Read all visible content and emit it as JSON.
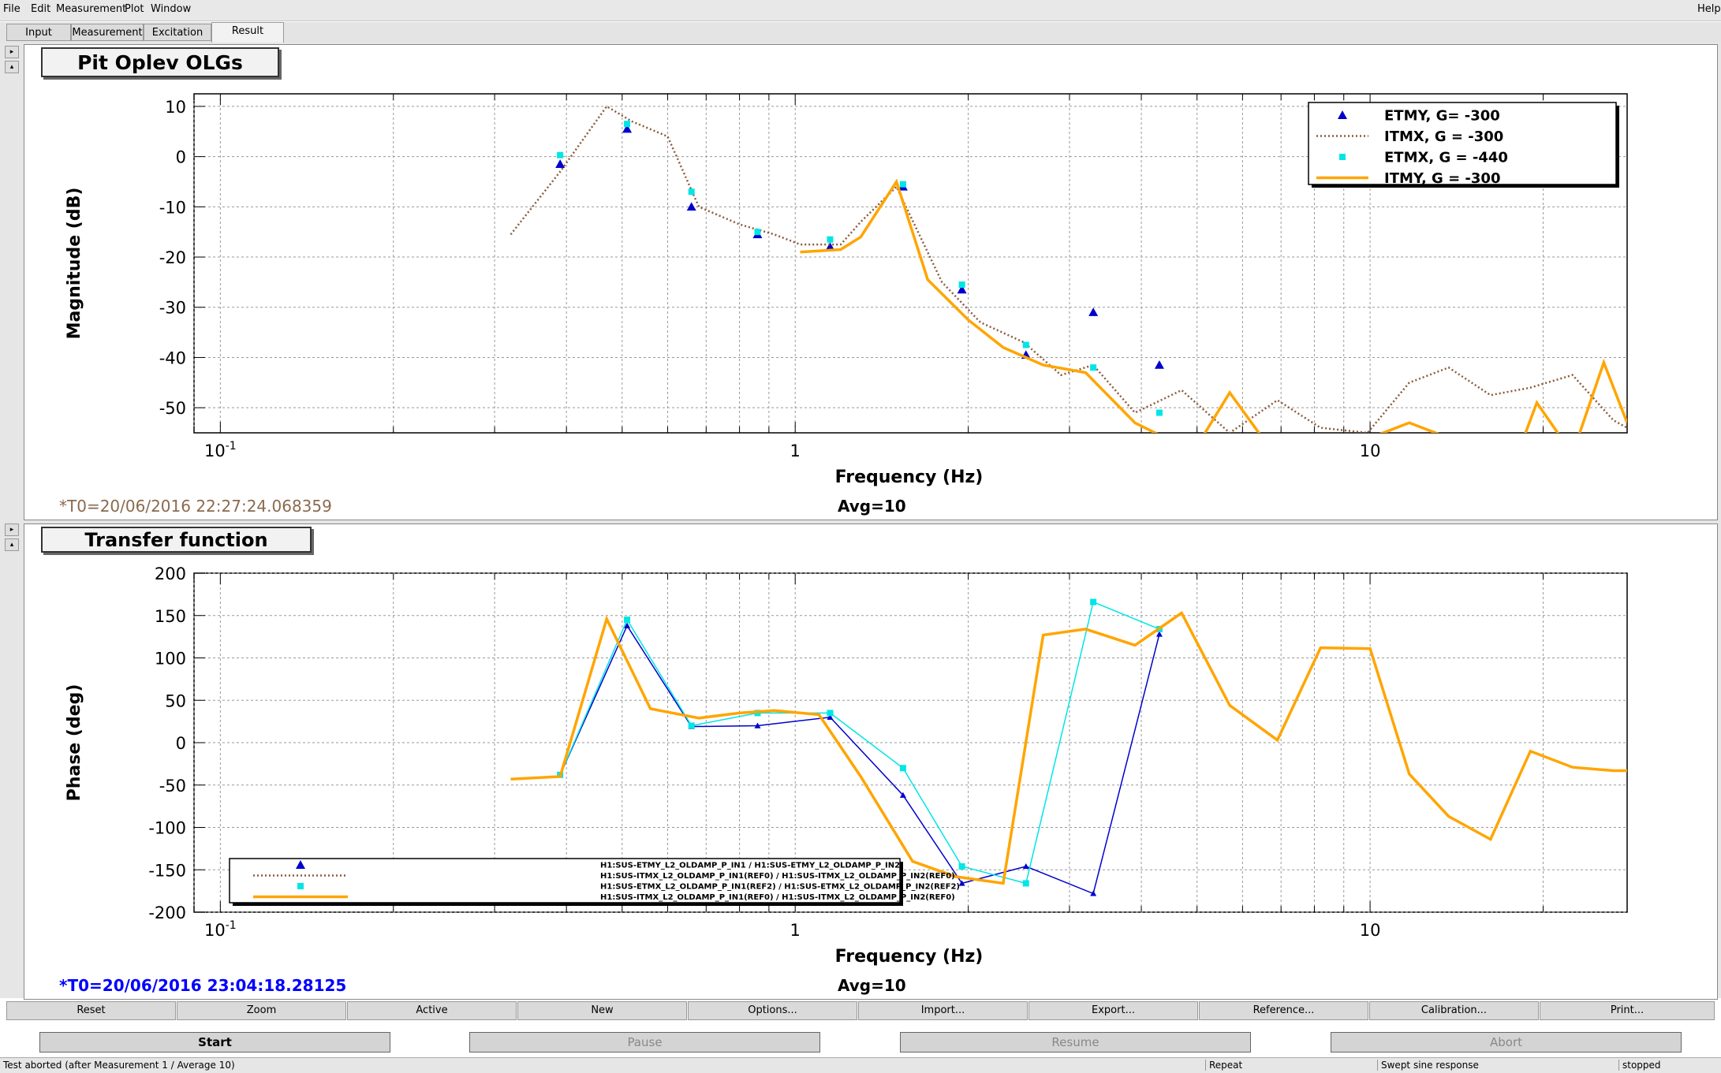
{
  "menubar": {
    "items": [
      "File",
      "Edit",
      "Measurement",
      "Plot",
      "Window"
    ],
    "help": "Help"
  },
  "tabs": [
    {
      "label": "Input",
      "active": false
    },
    {
      "label": "Measurement",
      "active": false
    },
    {
      "label": "Excitation",
      "active": false
    },
    {
      "label": "Result",
      "active": true
    }
  ],
  "pad1": {
    "title": "Pit Oplev OLGs",
    "timestamp": "*T0=20/06/2016 22:27:24.068359",
    "timestamp_color": "#8b6a4e",
    "avg": "Avg=10"
  },
  "pad2": {
    "title": "Transfer function",
    "timestamp": "*T0=20/06/2016 23:04:18.28125",
    "timestamp_color": "#0000ff",
    "avg": "Avg=10"
  },
  "chart_data": [
    {
      "type": "line",
      "xlabel": "Frequency (Hz)",
      "ylabel": "Magnitude (dB)",
      "xscale": "log",
      "xlim": [
        0.09,
        28
      ],
      "ylim": [
        -55,
        12.5
      ],
      "xticks": [
        {
          "v": 0.1,
          "base": "10",
          "exp": "-1"
        },
        {
          "v": 1,
          "base": "1",
          "exp": ""
        },
        {
          "v": 10,
          "base": "10",
          "exp": ""
        }
      ],
      "yticks": [
        10,
        0,
        -10,
        -20,
        -30,
        -40,
        -50
      ],
      "grid": true,
      "legend_position": "top-right",
      "series": [
        {
          "name": "ETMY, G= -300",
          "style": "triangle",
          "color": "#0000cc",
          "x": [
            0.39,
            0.51,
            0.66,
            0.86,
            1.15,
            1.54,
            1.95,
            2.52,
            3.3,
            4.3
          ],
          "y": [
            -1.5,
            5.5,
            -10,
            -15.5,
            -18,
            -6,
            -26.5,
            -39.5,
            -31,
            -41.5
          ]
        },
        {
          "name": "ITMX, G = -300",
          "style": "dotted",
          "color": "#8b5a3c",
          "x": [
            0.32,
            0.39,
            0.47,
            0.52,
            0.6,
            0.68,
            0.8,
            0.92,
            1.02,
            1.2,
            1.3,
            1.5,
            1.8,
            2.1,
            2.5,
            2.9,
            3.3,
            3.9,
            4.7,
            5.7,
            6.9,
            8.2,
            9.9,
            11.7,
            13.7,
            16.2,
            19.0,
            22.5,
            26.5,
            28
          ],
          "y": [
            -15.5,
            -3,
            10,
            7,
            4,
            -10,
            -13.5,
            -15.5,
            -17.5,
            -17.5,
            -13,
            -6,
            -25,
            -33,
            -37,
            -43.5,
            -41.5,
            -51,
            -46.5,
            -55,
            -48.5,
            -54,
            -55,
            -45,
            -42,
            -47.5,
            -46,
            -43.5,
            -52.5,
            -54
          ]
        },
        {
          "name": "ETMX, G = -440",
          "style": "square",
          "color": "#00e5e5",
          "x": [
            0.39,
            0.51,
            0.66,
            0.86,
            1.15,
            1.54,
            1.95,
            2.52,
            3.3,
            4.3
          ],
          "y": [
            0.3,
            6.5,
            -7,
            -15,
            -16.5,
            -5.5,
            -25.5,
            -37.5,
            -42,
            -51
          ]
        },
        {
          "name": "ITMY, G = -300",
          "style": "solid",
          "color": "#ffa500",
          "x": [
            1.02,
            1.2,
            1.3,
            1.5,
            1.7,
            2.0,
            2.3,
            2.7,
            3.2,
            3.9,
            4.4,
            5.1,
            5.7,
            6.5,
            8.0,
            10.0,
            11.7,
            13.7,
            16.0,
            18.5,
            19.5,
            21.5,
            23.0,
            25.5,
            28
          ],
          "y": [
            -19,
            -18.5,
            -16,
            -5,
            -24.5,
            -32.5,
            -38,
            -41.5,
            -43,
            -53,
            -56,
            -56,
            -47,
            -56,
            -56,
            -56,
            -53,
            -56,
            -56,
            -56,
            -49,
            -56,
            -56,
            -41,
            -53
          ]
        }
      ]
    },
    {
      "type": "line",
      "xlabel": "Frequency (Hz)",
      "ylabel": "Phase (deg)",
      "xscale": "log",
      "xlim": [
        0.09,
        28
      ],
      "ylim": [
        -200,
        200
      ],
      "xticks": [
        {
          "v": 0.1,
          "base": "10",
          "exp": "-1"
        },
        {
          "v": 1,
          "base": "1",
          "exp": ""
        },
        {
          "v": 10,
          "base": "10",
          "exp": ""
        }
      ],
      "yticks": [
        200,
        150,
        100,
        50,
        0,
        -50,
        -100,
        -150,
        -200
      ],
      "grid": true,
      "legend_position": "bottom-left",
      "series": [
        {
          "name": "H1:SUS-ETMY_L2_OLDAMP_P_IN1 / H1:SUS-ETMY_L2_OLDAMP_P_IN2",
          "style": "triangle-line",
          "color": "#0000cc",
          "x": [
            0.39,
            0.51,
            0.66,
            0.86,
            1.15,
            1.54,
            1.95,
            2.52,
            3.3,
            4.3
          ],
          "y": [
            -38,
            138,
            19,
            20,
            30,
            -62,
            -166,
            -146,
            -178,
            128
          ]
        },
        {
          "name": "H1:SUS-ITMX_L2_OLDAMP_P_IN1(REF0) / H1:SUS-ITMX_L2_OLDAMP_P_IN2(REF0)",
          "style": "dotted",
          "color": "#8b5a3c",
          "x": [
            0.32,
            0.39,
            0.47,
            0.56,
            0.68,
            0.8,
            0.92,
            1.1,
            1.3,
            1.6,
            1.9,
            2.3,
            2.7,
            3.2,
            3.9,
            4.7,
            5.7,
            6.9,
            8.2,
            10.0,
            11.7,
            13.7,
            16.2,
            19.0,
            22.5,
            26.5,
            28
          ],
          "y": [
            -43,
            -40,
            146,
            40,
            29,
            35,
            38,
            33,
            -40,
            -140,
            -158,
            -166,
            127,
            134,
            115,
            153,
            44,
            3,
            112,
            111,
            -37,
            -87,
            -114,
            -10,
            -29,
            -33,
            -33
          ]
        },
        {
          "name": "H1:SUS-ETMX_L2_OLDAMP_P_IN1(REF2) / H1:SUS-ETMX_L2_OLDAMP_P_IN2(REF2)",
          "style": "square-line",
          "color": "#00e5e5",
          "x": [
            0.39,
            0.51,
            0.66,
            0.86,
            1.15,
            1.54,
            1.95,
            2.52,
            3.3,
            4.3
          ],
          "y": [
            -38,
            145,
            20,
            35,
            35,
            -30,
            -146,
            -166,
            166,
            134
          ]
        },
        {
          "name": "H1:SUS-ITMX_L2_OLDAMP_P_IN1(REF0) / H1:SUS-ITMX_L2_OLDAMP_P_IN2(REF0)",
          "style": "solid",
          "color": "#ffa500",
          "x": [
            0.32,
            0.39,
            0.47,
            0.56,
            0.68,
            0.8,
            0.92,
            1.1,
            1.3,
            1.6,
            1.9,
            2.3,
            2.7,
            3.2,
            3.9,
            4.7,
            5.7,
            6.9,
            8.2,
            10.0,
            11.7,
            13.7,
            16.2,
            19.0,
            22.5,
            26.5,
            28
          ],
          "y": [
            -43,
            -40,
            146,
            40,
            29,
            35,
            38,
            33,
            -40,
            -140,
            -158,
            -166,
            127,
            134,
            115,
            153,
            44,
            3,
            112,
            111,
            -37,
            -87,
            -114,
            -10,
            -29,
            -33,
            -33
          ]
        }
      ]
    }
  ],
  "bottom_buttons": [
    "Reset",
    "Zoom",
    "Active",
    "New",
    "Options...",
    "Import...",
    "Export...",
    "Reference...",
    "Calibration...",
    "Print..."
  ],
  "action_buttons": {
    "start": "Start",
    "pause": "Pause",
    "resume": "Resume",
    "abort": "Abort"
  },
  "status": {
    "message": "Test aborted (after Measurement 1 / Average 10)",
    "repeat": "Repeat",
    "mode": "Swept sine response",
    "state": "stopped"
  }
}
